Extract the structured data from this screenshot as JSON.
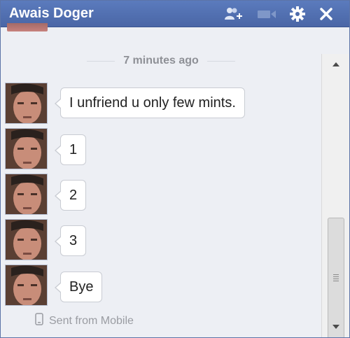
{
  "header": {
    "title": "Awais Doger",
    "icons": [
      "add-friend-icon",
      "video-call-icon",
      "gear-icon",
      "close-icon"
    ]
  },
  "conversation": {
    "timestamp": "7 minutes ago",
    "messages": [
      {
        "text": "I unfriend u only few mints."
      },
      {
        "text": "1"
      },
      {
        "text": "2"
      },
      {
        "text": "3"
      },
      {
        "text": "Bye"
      }
    ],
    "sent_from": "Sent from Mobile"
  },
  "colors": {
    "header": "#4a66a6",
    "body": "#edeff4",
    "bubble": "#ffffff"
  }
}
